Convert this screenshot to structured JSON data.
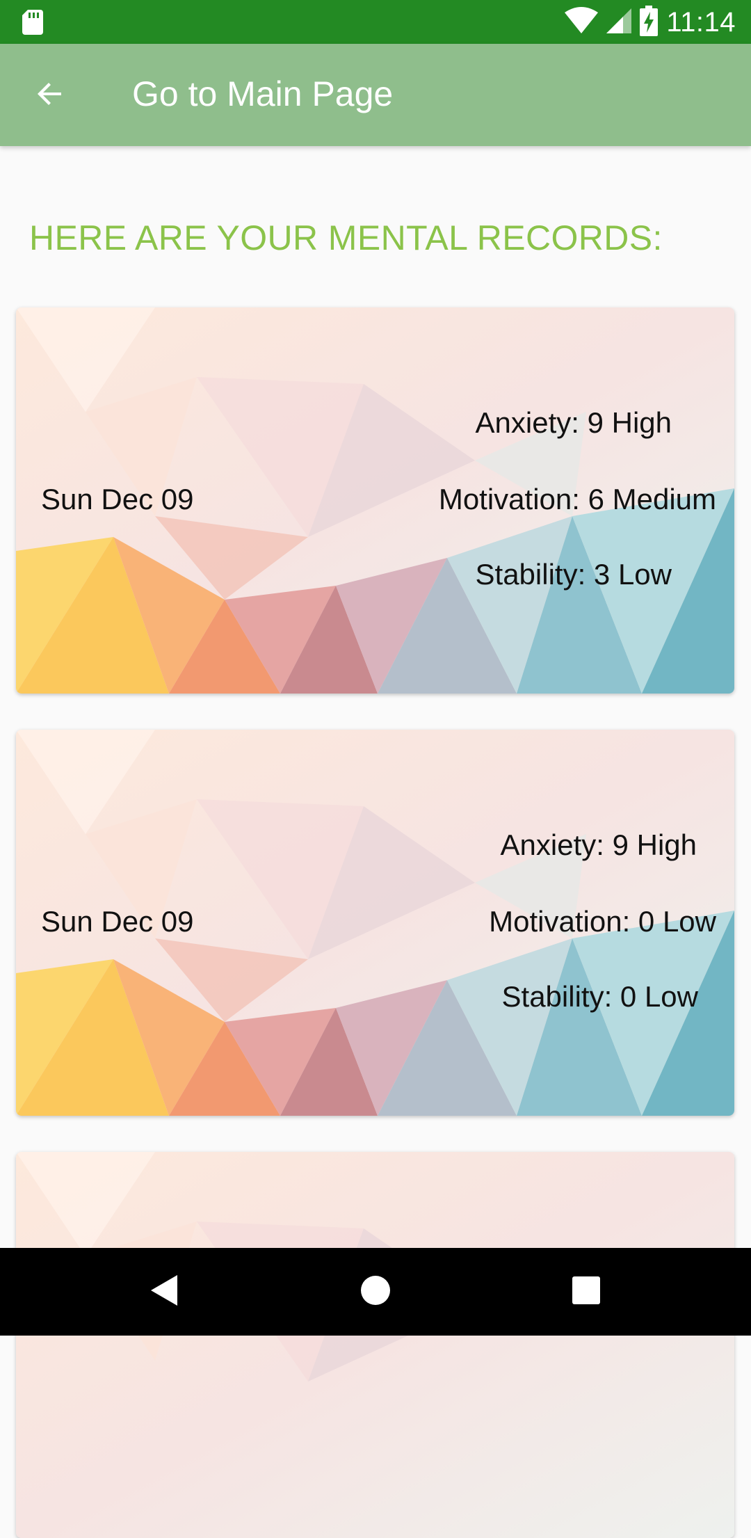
{
  "status_bar": {
    "time": "11:14",
    "icons": [
      "sd-card-icon",
      "wifi-icon",
      "signal-icon",
      "battery-charging-icon"
    ]
  },
  "app_bar": {
    "title": "Go to Main Page",
    "back_icon": "arrow-back-icon"
  },
  "heading": "HERE ARE YOUR MENTAL RECORDS:",
  "records": [
    {
      "date": "Sun Dec 09",
      "anxiety": "Anxiety: 9 High",
      "motivation": "Motivation: 6 Medium",
      "stability": "Stability: 3 Low"
    },
    {
      "date": "Sun Dec 09",
      "anxiety": "Anxiety: 9 High",
      "motivation": "Motivation: 0 Low",
      "stability": "Stability: 0 Low"
    }
  ],
  "nav_bar": {
    "icons": [
      "back-triangle-icon",
      "home-circle-icon",
      "recents-square-icon"
    ]
  },
  "colors": {
    "status_bar": "#238a23",
    "app_bar": "#8fbe8c",
    "heading": "#8bc34a",
    "background": "#fafafa"
  }
}
